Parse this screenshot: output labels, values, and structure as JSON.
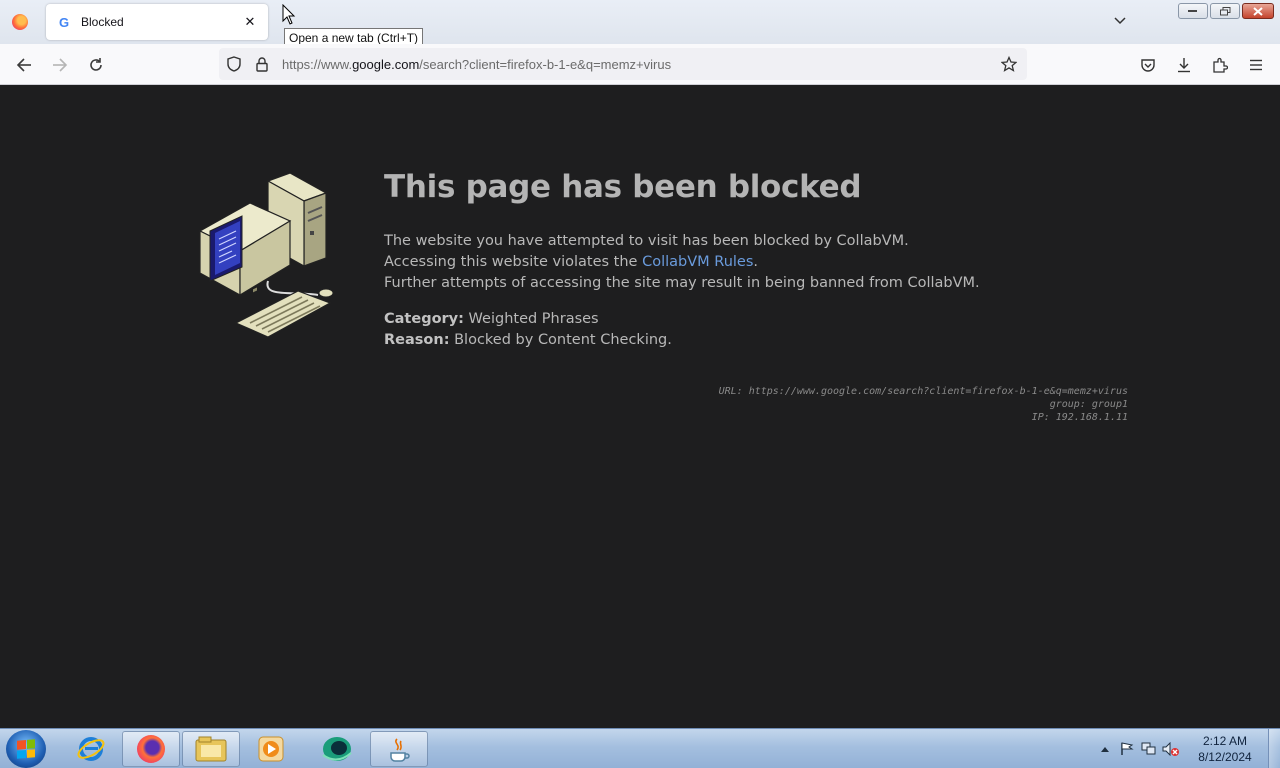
{
  "browser": {
    "tab": {
      "title": "Blocked",
      "favicon": "google-g-icon",
      "close_glyph": "✕"
    },
    "tooltip": "Open a new tab (Ctrl+T)",
    "url": {
      "prefix": "https://www.",
      "host": "google.com",
      "path": "/search?client=firefox-b-1-e&q=memz+virus"
    }
  },
  "page": {
    "headline": "This page has been blocked",
    "line1": "The website you have attempted to visit has been blocked by CollabVM.",
    "line2_pre": "Accessing this website violates the ",
    "line2_link": "CollabVM Rules",
    "line2_post": ".",
    "line3": "Further attempts of accessing the site may result in being banned from CollabVM.",
    "category_label": "Category:",
    "category_value": "Weighted Phrases",
    "reason_label": "Reason:",
    "reason_value": "Blocked by Content Checking.",
    "details": {
      "url_line": "URL: https://www.google.com/search?client=firefox-b-1-e&q=memz+virus",
      "group_line": "group: group1",
      "ip_line": "IP: 192.168.1.11"
    },
    "link_color": "#6a9bdc"
  },
  "taskbar": {
    "apps": [
      "internet-explorer-icon",
      "firefox-icon",
      "windows-explorer-icon",
      "media-player-icon",
      "green-app-icon",
      "java-icon"
    ],
    "clock_time": "2:12 AM",
    "clock_date": "8/12/2024"
  }
}
